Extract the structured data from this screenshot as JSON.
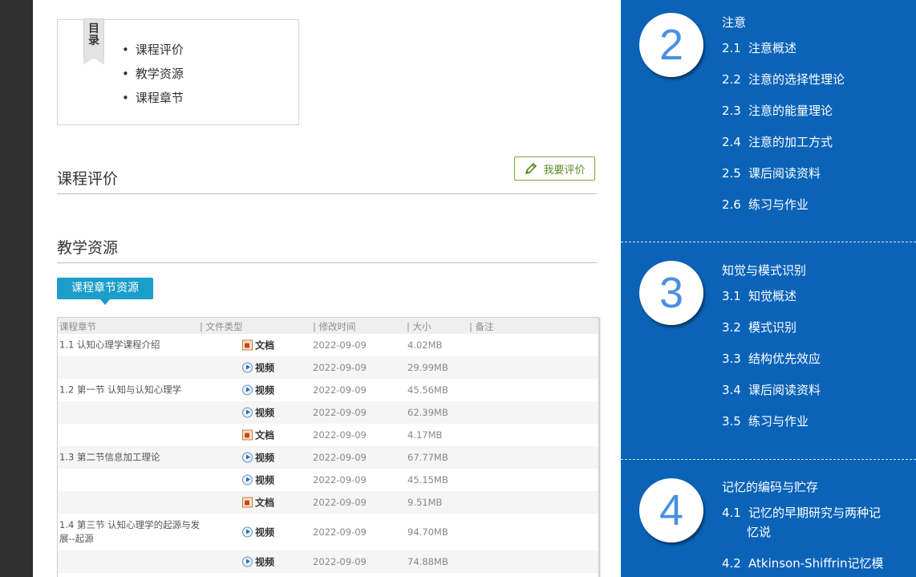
{
  "toc": {
    "ribbon": "目录",
    "items": [
      "课程评价",
      "教学资源",
      "课程章节"
    ]
  },
  "evaluation": {
    "title": "课程评价",
    "button_label": "我要评价"
  },
  "resources": {
    "title": "教学资源",
    "tab_label": "课程章节资源",
    "headers": [
      "课程章节",
      "| 文件类型",
      "| 修改时间",
      "| 大小",
      "| 备注"
    ],
    "rows": [
      {
        "chapter": "1.1 认知心理学课程介绍",
        "type": "文档",
        "date": "2022-09-09",
        "size": "4.02MB"
      },
      {
        "chapter": "",
        "type": "视频",
        "date": "2022-09-09",
        "size": "29.99MB"
      },
      {
        "chapter": "1.2 第一节 认知与认知心理学",
        "type": "视频",
        "date": "2022-09-09",
        "size": "45.56MB"
      },
      {
        "chapter": "",
        "type": "视频",
        "date": "2022-09-09",
        "size": "62.39MB"
      },
      {
        "chapter": "",
        "type": "文档",
        "date": "2022-09-09",
        "size": "4.17MB"
      },
      {
        "chapter": "1.3 第二节信息加工理论",
        "type": "视频",
        "date": "2022-09-09",
        "size": "67.77MB"
      },
      {
        "chapter": "",
        "type": "视频",
        "date": "2022-09-09",
        "size": "45.15MB"
      },
      {
        "chapter": "",
        "type": "文档",
        "date": "2022-09-09",
        "size": "9.51MB"
      },
      {
        "chapter": "1.4 第三节 认知心理学的起源与发展--起源",
        "type": "视频",
        "date": "2022-09-09",
        "size": "94.70MB"
      },
      {
        "chapter": "",
        "type": "视频",
        "date": "2022-09-09",
        "size": "74.88MB"
      }
    ]
  },
  "sidebar": {
    "chapters": [
      {
        "number": "2",
        "title": "注意",
        "items": [
          {
            "num": "2.1",
            "label": "注意概述"
          },
          {
            "num": "2.2",
            "label": "注意的选择性理论"
          },
          {
            "num": "2.3",
            "label": "注意的能量理论"
          },
          {
            "num": "2.4",
            "label": "注意的加工方式"
          },
          {
            "num": "2.5",
            "label": "课后阅读资料"
          },
          {
            "num": "2.6",
            "label": "练习与作业"
          }
        ]
      },
      {
        "number": "3",
        "title": "知觉与模式识别",
        "items": [
          {
            "num": "3.1",
            "label": "知觉概述"
          },
          {
            "num": "3.2",
            "label": "模式识别"
          },
          {
            "num": "3.3",
            "label": "结构优先效应"
          },
          {
            "num": "3.4",
            "label": "课后阅读资料"
          },
          {
            "num": "3.5",
            "label": "练习与作业"
          }
        ]
      },
      {
        "number": "4",
        "title": "记忆的编码与贮存",
        "items": [
          {
            "num": "4.1",
            "label": "记忆的早期研究与两种记",
            "label_cont": "忆说"
          },
          {
            "num": "4.2",
            "label": "Atkinson-Shiffrin记忆模"
          }
        ]
      }
    ]
  }
}
